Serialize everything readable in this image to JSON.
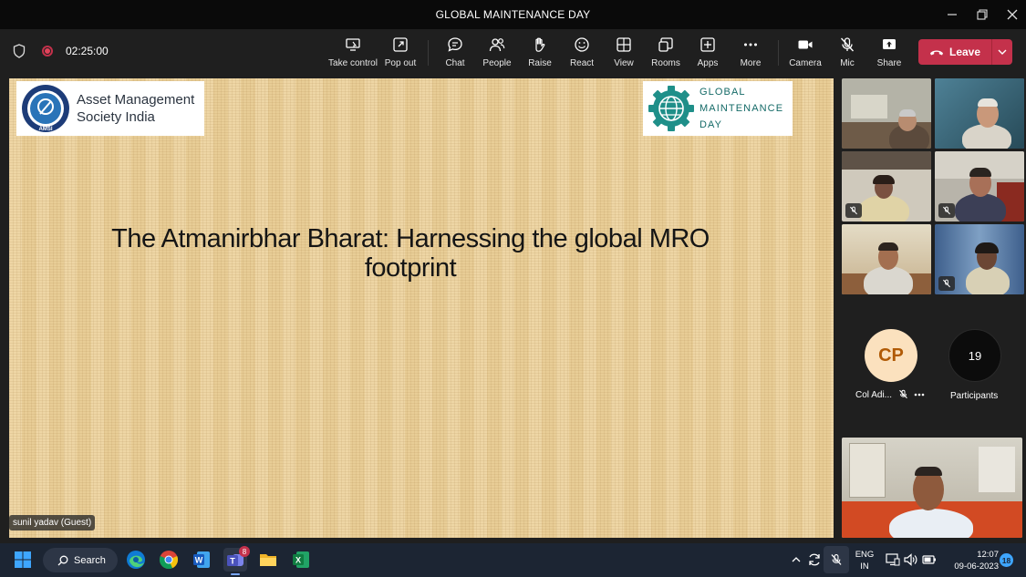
{
  "window": {
    "title": "GLOBAL MAINTENANCE DAY"
  },
  "meeting": {
    "timer": "02:25:00",
    "toolbar": [
      {
        "label": "Take control",
        "icon": "take-control-icon"
      },
      {
        "label": "Pop out",
        "icon": "pop-out-icon"
      },
      {
        "label": "Chat",
        "icon": "chat-icon"
      },
      {
        "label": "People",
        "icon": "people-icon"
      },
      {
        "label": "Raise",
        "icon": "raise-hand-icon"
      },
      {
        "label": "React",
        "icon": "react-icon"
      },
      {
        "label": "View",
        "icon": "view-icon"
      },
      {
        "label": "Rooms",
        "icon": "rooms-icon"
      },
      {
        "label": "Apps",
        "icon": "apps-icon"
      },
      {
        "label": "More",
        "icon": "more-icon"
      },
      {
        "label": "Camera",
        "icon": "camera-icon"
      },
      {
        "label": "Mic",
        "icon": "mic-off-icon"
      },
      {
        "label": "Share",
        "icon": "share-icon"
      }
    ],
    "leave_label": "Leave"
  },
  "slide": {
    "org_name_line1": "Asset Management",
    "org_name_line2": "Society India",
    "seal_text": "AMSI",
    "gmd_line1": "GLOBAL",
    "gmd_line2": "MAINTENANCE",
    "gmd_line3": "DAY",
    "title_line1": "The Atmanirbhar Bharat: Harnessing the global MRO",
    "title_line2": "footprint",
    "presenter": "sunil yadav (Guest)"
  },
  "participants_panel": {
    "avatar_initials": "CP",
    "avatar_name": "Col Adi...",
    "participants_count": "19",
    "participants_label": "Participants"
  },
  "taskbar": {
    "search_label": "Search",
    "teams_badge": "8",
    "lang_line1": "ENG",
    "lang_line2": "IN",
    "time": "12:07",
    "date": "09-06-2023",
    "notif_count": "18"
  },
  "colors": {
    "leave_red": "#c4314b",
    "slide_bg": "#e8cd96",
    "active_outline": "#7f85f5",
    "gmd_teal": "#146a67",
    "avatar_bg": "#fbe1be",
    "avatar_fg": "#b05a06"
  }
}
